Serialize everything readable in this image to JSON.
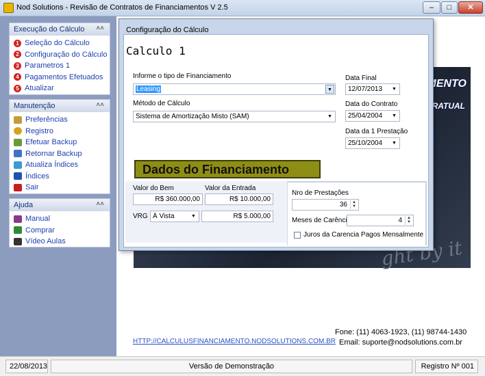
{
  "window": {
    "title": "Nod Solutions -  Revisão de Contratos de Financiamentos V 2.5"
  },
  "sidebar": {
    "groups": [
      {
        "title": "Execução do Cálculo",
        "items": [
          {
            "num": "1",
            "label": "Seleção do Cálculo"
          },
          {
            "num": "2",
            "label": "Configuração do Cálculo"
          },
          {
            "num": "3",
            "label": "Parametros 1"
          },
          {
            "num": "4",
            "label": "Pagamentos Efetuados"
          },
          {
            "num": "5",
            "label": "Atualizar"
          }
        ]
      },
      {
        "title": "Manutenção",
        "items": [
          {
            "icon": "preferences-icon",
            "color": "#c79a3a",
            "label": "Preferências"
          },
          {
            "icon": "key-icon",
            "color": "#d6a21a",
            "label": "Registro"
          },
          {
            "icon": "backup-icon",
            "color": "#6b9a3a",
            "label": "Efetuar Backup"
          },
          {
            "icon": "restore-backup-icon",
            "color": "#3e73c2",
            "label": "Retornar Backup"
          },
          {
            "icon": "update-indexes-icon",
            "color": "#3f9ad0",
            "label": "Atualiza Índices"
          },
          {
            "icon": "indexes-icon",
            "color": "#2050b0",
            "label": "Índices"
          },
          {
            "icon": "exit-icon",
            "color": "#c41e1e",
            "label": "Sair"
          }
        ]
      },
      {
        "title": "Ajuda",
        "items": [
          {
            "icon": "manual-icon",
            "color": "#8a3a8a",
            "label": "Manual"
          },
          {
            "icon": "buy-icon",
            "color": "#2e8a3a",
            "label": "Comprar"
          },
          {
            "icon": "video-icon",
            "color": "#333333",
            "label": "Vídeo Aulas"
          }
        ]
      }
    ],
    "collapse_glyph": "˄˄"
  },
  "background": {
    "line1": "MENTO",
    "line2": "RATUAL",
    "line3": "ght by it"
  },
  "dialog": {
    "title": "Configuração do Cálculo",
    "heading": "Calculo 1",
    "financing_type_label": "Informe o tipo de Financiamento",
    "financing_type_value": "Leasing",
    "calc_method_label": "Método de Cálculo",
    "calc_method_value": "Sistema de Amortização Misto (SAM)",
    "final_date_label": "Data Final",
    "final_date_value": "12/07/2013",
    "contract_date_label": "Data do Contrato",
    "contract_date_value": "25/04/2004",
    "first_installment_label": "Data da 1 Prestação",
    "first_installment_value": "25/10/2004",
    "section_button": "Dados do Financiamento",
    "asset_value_label": "Valor do Bem",
    "asset_value": "R$ 360.000,00",
    "down_payment_label": "Valor da Entrada",
    "down_payment_value": "R$ 10.000,00",
    "vrg_label": "VRG",
    "vrg_mode": "À Vista",
    "vrg_value": "R$ 5.000,00",
    "installments_label": "Nro de Prestações",
    "installments_value": "36",
    "grace_label": "Meses de Carência",
    "grace_value": "4",
    "grace_interest_label": "Juros da Carencia Pagos Mensalmente"
  },
  "footer": {
    "url": "HTTP://CALCULUSFINANCIAMENTO.NODSOLUTIONS.COM.BR",
    "phone": "Fone: (11) 4063-1923, (11) 98744-1430",
    "email": "Email: suporte@nodsolutions.com.br"
  },
  "status": {
    "date": "22/08/2013",
    "version": "Versão de Demonstração",
    "registration": "Registro Nº 001"
  }
}
